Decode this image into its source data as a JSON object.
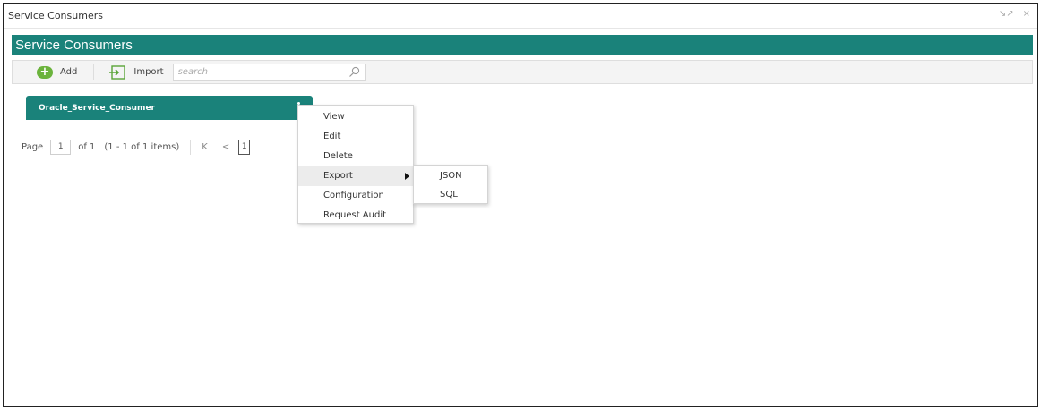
{
  "window": {
    "title": "Service Consumers",
    "minimize_glyph": "↘↗",
    "close_glyph": "×"
  },
  "header": {
    "title": "Service Consumers"
  },
  "toolbar": {
    "add_label": "Add",
    "import_label": "Import",
    "search_placeholder": "search",
    "search_value": ""
  },
  "cards": [
    {
      "name": "Oracle_Service_Consumer"
    }
  ],
  "pager": {
    "page_label": "Page",
    "current_page": "1",
    "of_label": "of 1",
    "items_label": "(1 - 1 of 1 items)",
    "first_glyph": "K",
    "prev_glyph": "<",
    "page_button": "1"
  },
  "context_menu": {
    "items": [
      {
        "label": "View"
      },
      {
        "label": "Edit"
      },
      {
        "label": "Delete"
      },
      {
        "label": "Export",
        "active": true,
        "has_submenu": true
      },
      {
        "label": "Configuration"
      },
      {
        "label": "Request Audit"
      }
    ],
    "export_submenu": [
      {
        "label": "JSON"
      },
      {
        "label": "SQL"
      }
    ]
  },
  "colors": {
    "accent": "#1a827a",
    "add_icon": "#6bb33c"
  },
  "icons": {
    "add": "plus-circle-icon",
    "import": "import-icon",
    "search": "search-icon",
    "kebab": "kebab-menu-icon"
  }
}
